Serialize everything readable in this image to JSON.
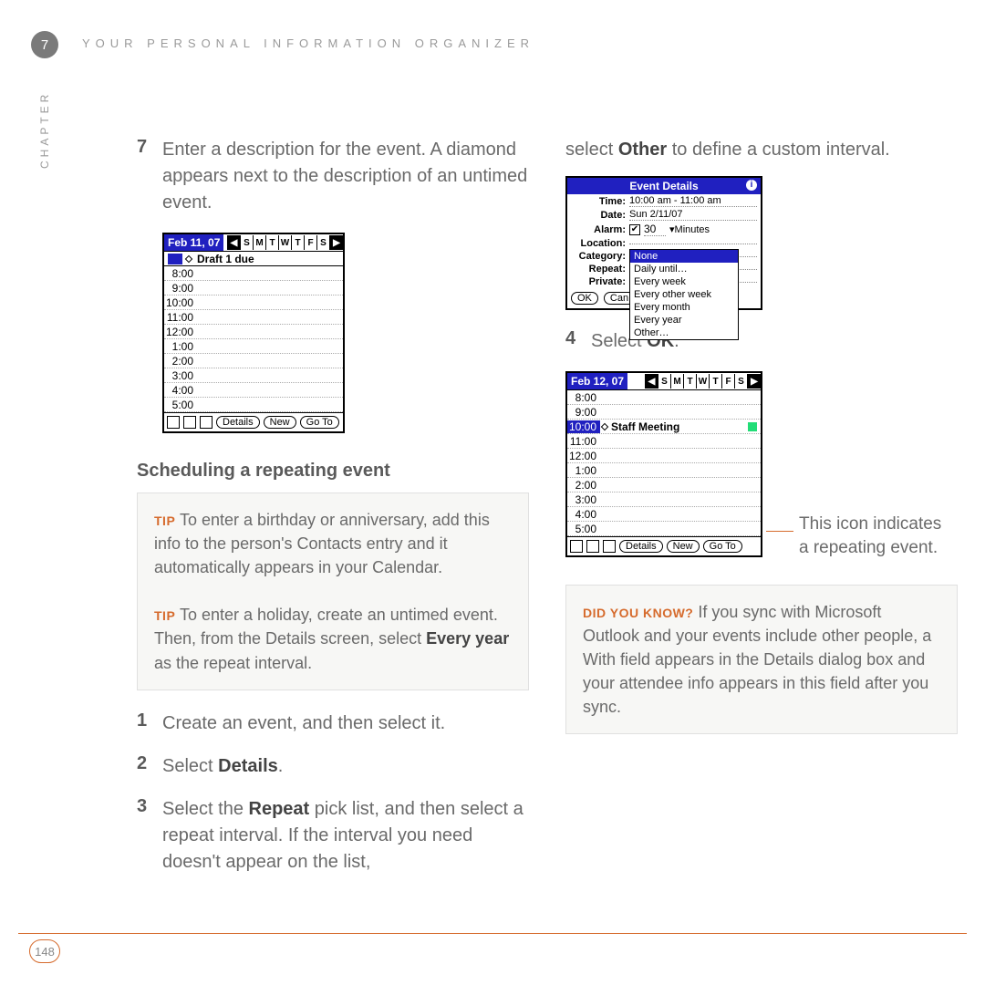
{
  "header": {
    "chapter_num": "7",
    "running_head": "YOUR PERSONAL INFORMATION ORGANIZER",
    "side_label": "CHAPTER"
  },
  "col1": {
    "step7_num": "7",
    "step7_text_a": "Enter a description for the event. A diamond appears next to the description of an untimed event.",
    "screenshot1": {
      "date": "Feb 11, 07",
      "days": [
        "S",
        "M",
        "T",
        "W",
        "T",
        "F",
        "S"
      ],
      "untimed_event": "Draft 1 due",
      "times": [
        "8:00",
        "9:00",
        "10:00",
        "11:00",
        "12:00",
        "1:00",
        "2:00",
        "3:00",
        "4:00",
        "5:00"
      ],
      "btn_details": "Details",
      "btn_new": "New",
      "btn_goto": "Go To"
    },
    "subhead": "Scheduling a repeating event",
    "tip1_label": "TIP",
    "tip1_text": "To enter a birthday or anniversary, add this info to the person's Contacts entry and it automatically appears in your Calendar.",
    "tip2_label": "TIP",
    "tip2_text_a": "To enter a holiday, create an untimed event. Then, from the Details screen, select ",
    "tip2_bold": "Every year",
    "tip2_text_b": " as the repeat interval.",
    "step1_num": "1",
    "step1_text": "Create an event, and then select it.",
    "step2_num": "2",
    "step2_text_a": "Select ",
    "step2_bold": "Details",
    "step2_text_b": ".",
    "step3_num": "3",
    "step3_text_a": "Select the ",
    "step3_bold": "Repeat",
    "step3_text_b": " pick list, and then select a repeat interval. If the interval you need doesn't appear on the list,"
  },
  "col2": {
    "cont_text_a": "select ",
    "cont_bold": "Other",
    "cont_text_b": " to define a custom interval.",
    "screenshot2": {
      "title": "Event Details",
      "labels": {
        "time": "Time:",
        "date": "Date:",
        "alarm": "Alarm:",
        "location": "Location:",
        "category": "Category:",
        "repeat": "Repeat:",
        "private": "Private:"
      },
      "time_val": "10:00 am - 11:00 am",
      "date_val": "Sun 2/11/07",
      "alarm_val": "30",
      "alarm_unit": "Minutes",
      "repeat_options": [
        "None",
        "Daily until…",
        "Every week",
        "Every other week",
        "Every month",
        "Every year",
        "Other…"
      ],
      "btn_ok": "OK",
      "btn_cancel": "Can"
    },
    "step4_num": "4",
    "step4_text_a": "Select ",
    "step4_bold": "OK",
    "step4_text_b": ".",
    "screenshot3": {
      "date": "Feb 12, 07",
      "days": [
        "S",
        "M",
        "T",
        "W",
        "T",
        "F",
        "S"
      ],
      "times": [
        "8:00",
        "9:00",
        "10:00",
        "11:00",
        "12:00",
        "1:00",
        "2:00",
        "3:00",
        "4:00",
        "5:00"
      ],
      "event_time": "10:00",
      "event_name": "Staff Meeting",
      "btn_details": "Details",
      "btn_new": "New",
      "btn_goto": "Go To"
    },
    "callout_text": "This icon indicates a repeating event.",
    "dyk_label": "DID YOU KNOW?",
    "dyk_text": "If you sync with Microsoft Outlook and your events include other people, a With field appears in the Details dialog box and your attendee info appears in this field after you sync."
  },
  "footer": {
    "page": "148"
  }
}
